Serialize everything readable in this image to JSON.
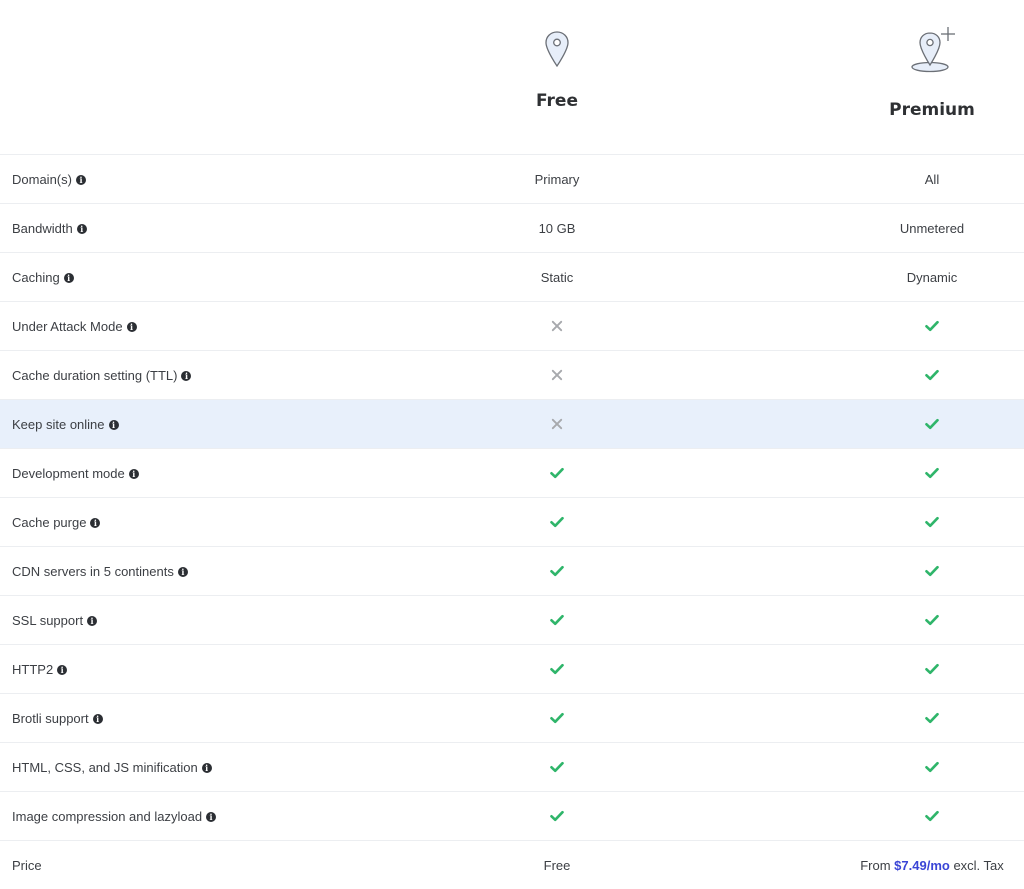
{
  "plans": {
    "free": {
      "name": "Free",
      "icon": "map-pin-icon"
    },
    "premium": {
      "name": "Premium",
      "icon": "map-pin-plus-icon"
    }
  },
  "colors": {
    "check": "#2fb56a",
    "cross": "#a7a9ad",
    "highlight_row": "#e8f0fb",
    "price_accent": "#3a45d6"
  },
  "rows": [
    {
      "feature": "Domain(s)",
      "info": true,
      "free": {
        "type": "text",
        "text": "Primary"
      },
      "premium": {
        "type": "text",
        "text": "All"
      }
    },
    {
      "feature": "Bandwidth",
      "info": true,
      "free": {
        "type": "text",
        "text": "10 GB"
      },
      "premium": {
        "type": "text",
        "text": "Unmetered"
      }
    },
    {
      "feature": "Caching",
      "info": true,
      "free": {
        "type": "text",
        "text": "Static"
      },
      "premium": {
        "type": "text",
        "text": "Dynamic"
      }
    },
    {
      "feature": "Under Attack Mode",
      "info": true,
      "free": {
        "type": "cross"
      },
      "premium": {
        "type": "check"
      }
    },
    {
      "feature": "Cache duration setting (TTL)",
      "info": true,
      "free": {
        "type": "cross"
      },
      "premium": {
        "type": "check"
      }
    },
    {
      "feature": "Keep site online",
      "info": true,
      "highlight": true,
      "free": {
        "type": "cross"
      },
      "premium": {
        "type": "check"
      }
    },
    {
      "feature": "Development mode",
      "info": true,
      "free": {
        "type": "check"
      },
      "premium": {
        "type": "check"
      }
    },
    {
      "feature": "Cache purge",
      "info": true,
      "free": {
        "type": "check"
      },
      "premium": {
        "type": "check"
      }
    },
    {
      "feature": "CDN servers in 5 continents",
      "info": true,
      "free": {
        "type": "check"
      },
      "premium": {
        "type": "check"
      }
    },
    {
      "feature": "SSL support",
      "info": true,
      "free": {
        "type": "check"
      },
      "premium": {
        "type": "check"
      }
    },
    {
      "feature": "HTTP2",
      "info": true,
      "free": {
        "type": "check"
      },
      "premium": {
        "type": "check"
      }
    },
    {
      "feature": "Brotli support",
      "info": true,
      "free": {
        "type": "check"
      },
      "premium": {
        "type": "check"
      }
    },
    {
      "feature": "HTML, CSS, and JS minification",
      "info": true,
      "free": {
        "type": "check"
      },
      "premium": {
        "type": "check"
      }
    },
    {
      "feature": "Image compression and lazyload",
      "info": true,
      "free": {
        "type": "check"
      },
      "premium": {
        "type": "check"
      }
    },
    {
      "feature": "Price",
      "info": false,
      "free": {
        "type": "text",
        "text": "Free"
      },
      "premium": {
        "type": "price",
        "prefix": "From ",
        "link": "$7.49/mo",
        "suffix": " excl. Tax"
      }
    }
  ]
}
